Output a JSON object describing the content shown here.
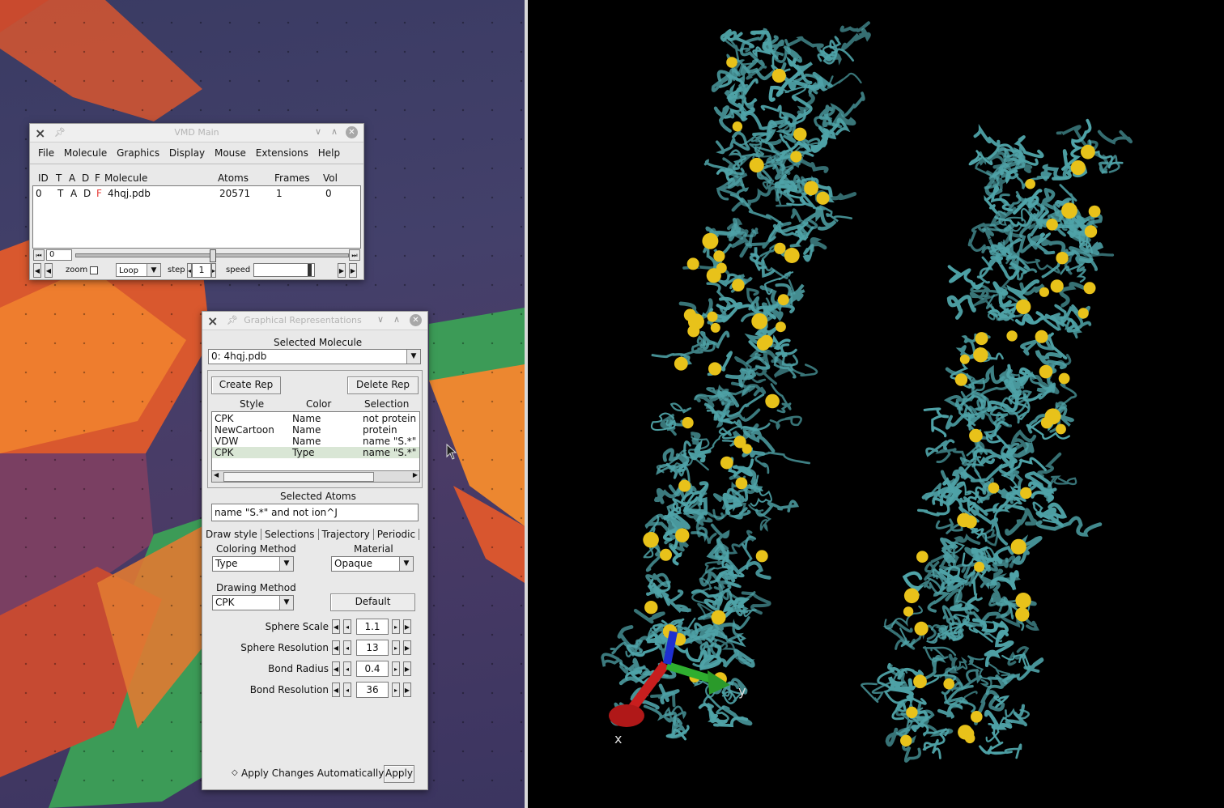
{
  "vmd_main": {
    "title": "VMD Main",
    "menu": [
      "File",
      "Molecule",
      "Graphics",
      "Display",
      "Mouse",
      "Extensions",
      "Help"
    ],
    "columns": {
      "id": "ID",
      "t": "T",
      "a": "A",
      "d": "D",
      "f": "F",
      "molecule": "Molecule",
      "atoms": "Atoms",
      "frames": "Frames",
      "vol": "Vol"
    },
    "row": {
      "id": "0",
      "t": "T",
      "a": "A",
      "d": "D",
      "f": "F",
      "molecule": "4hqj.pdb",
      "atoms": "20571",
      "frames": "1",
      "vol": "0"
    },
    "frame_value": "0",
    "zoom_label": "zoom",
    "loop_value": "Loop",
    "step_label": "step",
    "step_value": "1",
    "speed_label": "speed",
    "frame_highlight_color": "#e53935"
  },
  "graph_reps": {
    "title": "Graphical Representations",
    "selected_molecule_label": "Selected Molecule",
    "selected_molecule_value": "0: 4hqj.pdb",
    "create_rep": "Create Rep",
    "delete_rep": "Delete Rep",
    "headers": {
      "style": "Style",
      "color": "Color",
      "selection": "Selection"
    },
    "reps": [
      {
        "style": "CPK",
        "color": "Name",
        "selection": "not protein"
      },
      {
        "style": "NewCartoon",
        "color": "Name",
        "selection": "protein"
      },
      {
        "style": "VDW",
        "color": "Name",
        "selection": "name \"S.*\" a"
      },
      {
        "style": "CPK",
        "color": "Type",
        "selection": "name \"S.*\" a"
      }
    ],
    "selected_atoms_label": "Selected Atoms",
    "selected_atoms_value": "name \"S.*\" and not ion^J",
    "tabs": [
      "Draw style",
      "Selections",
      "Trajectory",
      "Periodic"
    ],
    "coloring_method_label": "Coloring Method",
    "coloring_method_value": "Type",
    "material_label": "Material",
    "material_value": "Opaque",
    "drawing_method_label": "Drawing Method",
    "drawing_method_value": "CPK",
    "default_button": "Default",
    "params": [
      {
        "label": "Sphere Scale",
        "value": "1.1"
      },
      {
        "label": "Sphere Resolution",
        "value": "13"
      },
      {
        "label": "Bond Radius",
        "value": "0.4"
      },
      {
        "label": "Bond Resolution",
        "value": "36"
      }
    ],
    "apply_auto": "Apply Changes Automatically",
    "apply": "Apply"
  },
  "viewer": {
    "axis_x": "x",
    "axis_y": "y",
    "protein_color": "#4fa3a8",
    "sulfur_color": "#e8c21a"
  },
  "icons": [
    "x-logo-icon",
    "pin-icon",
    "minimize-icon",
    "maximize-icon",
    "close-icon",
    "mouse-cursor-icon"
  ]
}
